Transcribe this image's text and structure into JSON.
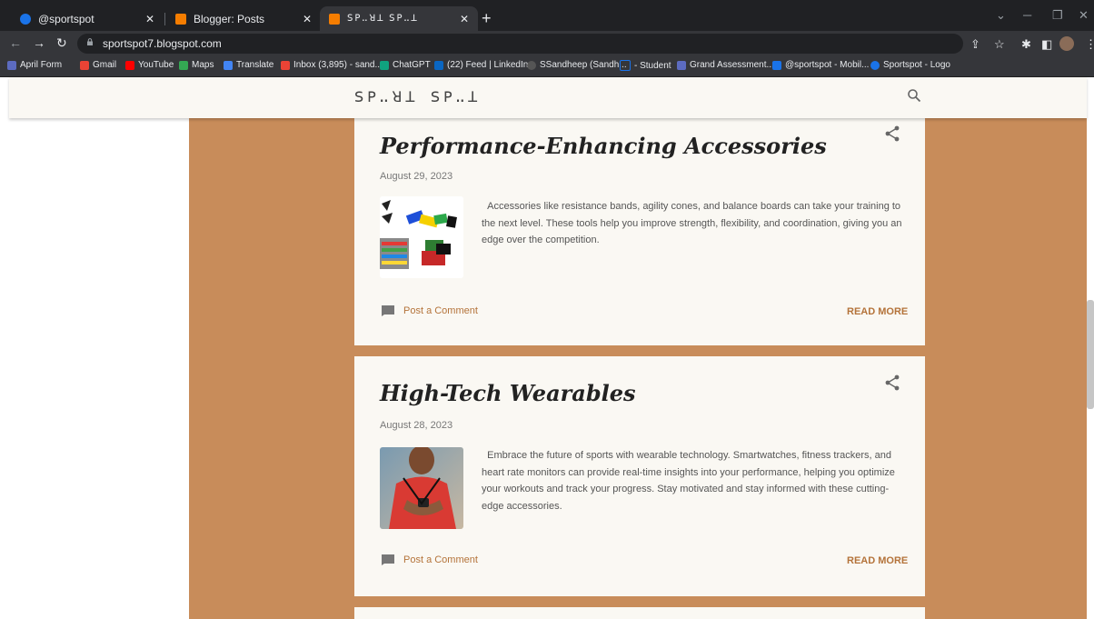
{
  "browser": {
    "tabs": [
      {
        "title": "@sportspot",
        "color": "#1a73e8"
      },
      {
        "title": "Blogger: Posts",
        "color": "#f57d00"
      },
      {
        "title": "ꓢꓑꓺꓤꓕ ꓢꓑꓺꓕ",
        "color": "#f57d00"
      }
    ],
    "url": "sportspot7.blogspot.com",
    "bookmarks": [
      {
        "label": "April Form",
        "color": "#5c6bc0"
      },
      {
        "label": "Gmail",
        "color": "#ea4335"
      },
      {
        "label": "YouTube",
        "color": "#ff0000"
      },
      {
        "label": "Maps",
        "color": "#34a853"
      },
      {
        "label": "Translate",
        "color": "#4285f4"
      },
      {
        "label": "Inbox (3,895) - sand...",
        "color": "#ea4335"
      },
      {
        "label": "ChatGPT",
        "color": "#10a37f"
      },
      {
        "label": "(22) Feed | LinkedIn",
        "color": "#0a66c2"
      },
      {
        "label": "SSandheep (Sandh...",
        "color": "#555555"
      },
      {
        "label": "- Student",
        "color": "#1a73e8"
      },
      {
        "label": "Grand Assessment...",
        "color": "#5c6bc0"
      },
      {
        "label": "@sportspot - Mobil...",
        "color": "#1a73e8"
      },
      {
        "label": "Sportspot - Logo",
        "color": "#1a73e8"
      }
    ]
  },
  "site": {
    "logo": "ꓢꓑꓺꓤꓕ ꓢꓑꓺꓕ"
  },
  "posts": [
    {
      "title": "Performance-Enhancing Accessories",
      "date": "August 29, 2023",
      "excerpt": "Accessories like resistance bands, agility cones, and balance boards can take your training to the next level. These tools help you improve strength, flexibility, and coordination, giving you an edge over the competition.",
      "comment_label": "Post a Comment",
      "read_more": "READ MORE"
    },
    {
      "title": "High-Tech Wearables",
      "date": "August 28, 2023",
      "excerpt": "Embrace the future of sports with wearable technology. Smartwatches, fitness trackers, and heart rate monitors can provide real-time insights into your performance, helping you optimize your workouts and track your progress. Stay motivated and stay informed with these cutting-edge accessories.",
      "comment_label": "Post a Comment",
      "read_more": "READ MORE"
    }
  ],
  "colors": {
    "page_accent": "#c88c5a",
    "link": "#b4733a",
    "card_bg": "#faf8f3"
  }
}
